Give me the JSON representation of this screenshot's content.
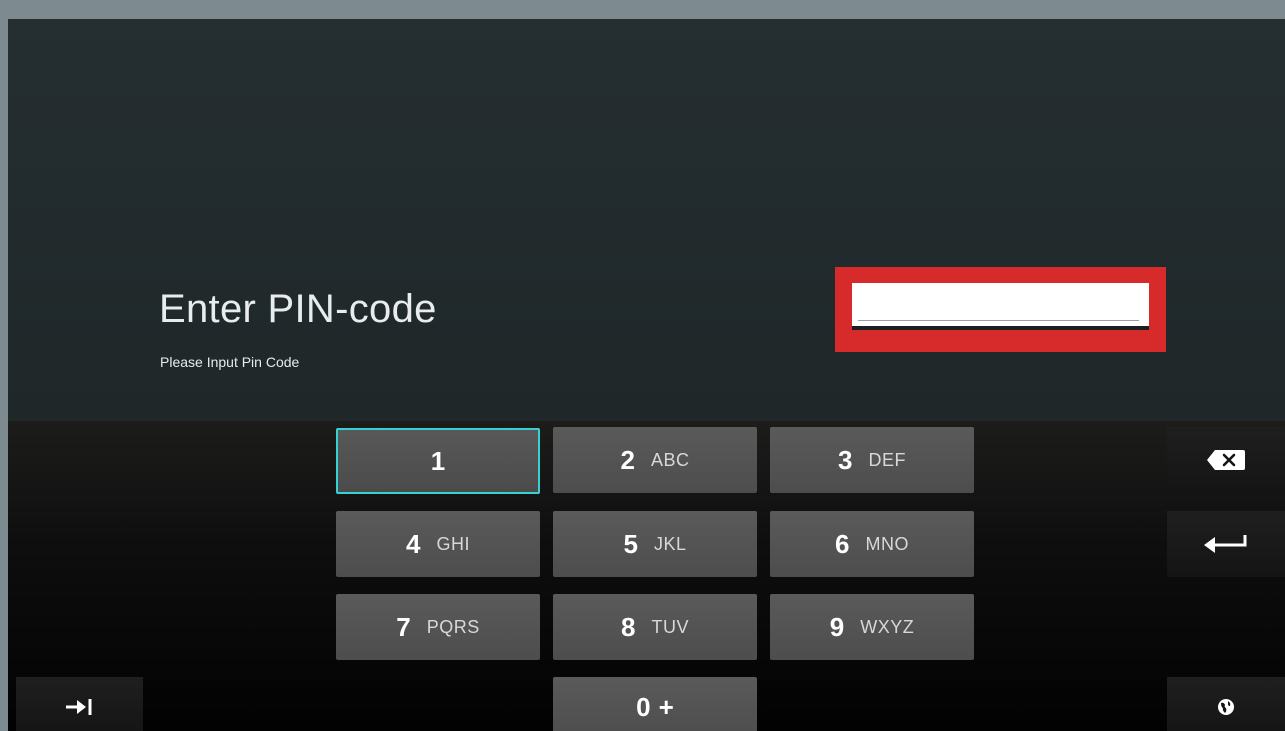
{
  "header": {
    "title": "Enter PIN-code",
    "subtitle": "Please Input Pin Code"
  },
  "pin_input": {
    "value": "",
    "highlight_color": "#d72a2a"
  },
  "keypad": {
    "keys": [
      {
        "digit": "1",
        "letters": ""
      },
      {
        "digit": "2",
        "letters": "ABC"
      },
      {
        "digit": "3",
        "letters": "DEF"
      },
      {
        "digit": "4",
        "letters": "GHI"
      },
      {
        "digit": "5",
        "letters": "JKL"
      },
      {
        "digit": "6",
        "letters": "MNO"
      },
      {
        "digit": "7",
        "letters": "PQRS"
      },
      {
        "digit": "8",
        "letters": "TUV"
      },
      {
        "digit": "9",
        "letters": "WXYZ"
      },
      {
        "digit": "0",
        "letters": "+"
      }
    ],
    "focused_key": "1",
    "focus_color": "#38d1d3"
  },
  "side_keys": {
    "backspace_icon": "backspace-icon",
    "enter_icon": "enter-arrow-icon",
    "tab_icon": "tab-arrow-icon",
    "language_icon": "globe-icon"
  }
}
